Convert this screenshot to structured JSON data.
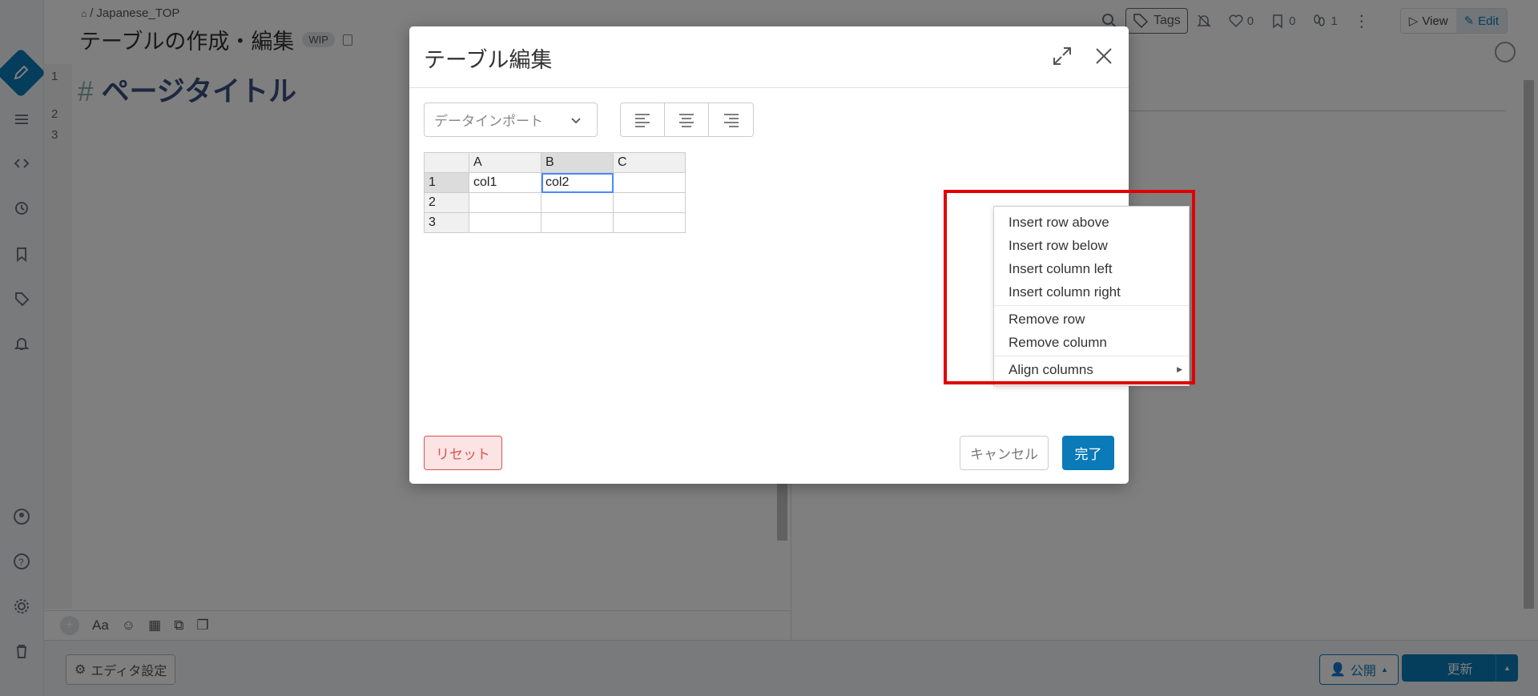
{
  "breadcrumb": {
    "home_icon": "home-icon",
    "separator": "/",
    "path": "Japanese_TOP"
  },
  "page": {
    "title": "テーブルの作成・編集",
    "wip_badge": "WIP"
  },
  "header": {
    "tags_label": "Tags",
    "likes_count": "0",
    "bookmarks_count": "0",
    "seen_count": "1",
    "view_label": "View",
    "edit_label": "Edit"
  },
  "editor": {
    "line_numbers": [
      "1",
      "2",
      "3"
    ],
    "heading_hash": "#",
    "heading_text": "ページタイトル",
    "toolbar_font_label": "Aa"
  },
  "footer": {
    "editor_settings_label": "エディタ設定",
    "publish_label": "公開",
    "update_label": "更新"
  },
  "modal": {
    "title": "テーブル編集",
    "import_dropdown_label": "データインポート",
    "grid": {
      "column_headers": [
        "A",
        "B",
        "C"
      ],
      "row_headers": [
        "1",
        "2",
        "3"
      ],
      "rows": [
        [
          "col1",
          "col2",
          ""
        ],
        [
          "",
          "",
          ""
        ],
        [
          "",
          "",
          ""
        ]
      ]
    },
    "context_menu": {
      "group1": [
        "Insert row above",
        "Insert row below",
        "Insert column left",
        "Insert column right"
      ],
      "group2": [
        "Remove row",
        "Remove column"
      ],
      "group3": [
        "Align columns"
      ]
    },
    "reset_label": "リセット",
    "cancel_label": "キャンセル",
    "done_label": "完了"
  },
  "colors": {
    "accent": "#0b7ab8",
    "highlight": "#e00000",
    "reset": "#d9534f"
  }
}
